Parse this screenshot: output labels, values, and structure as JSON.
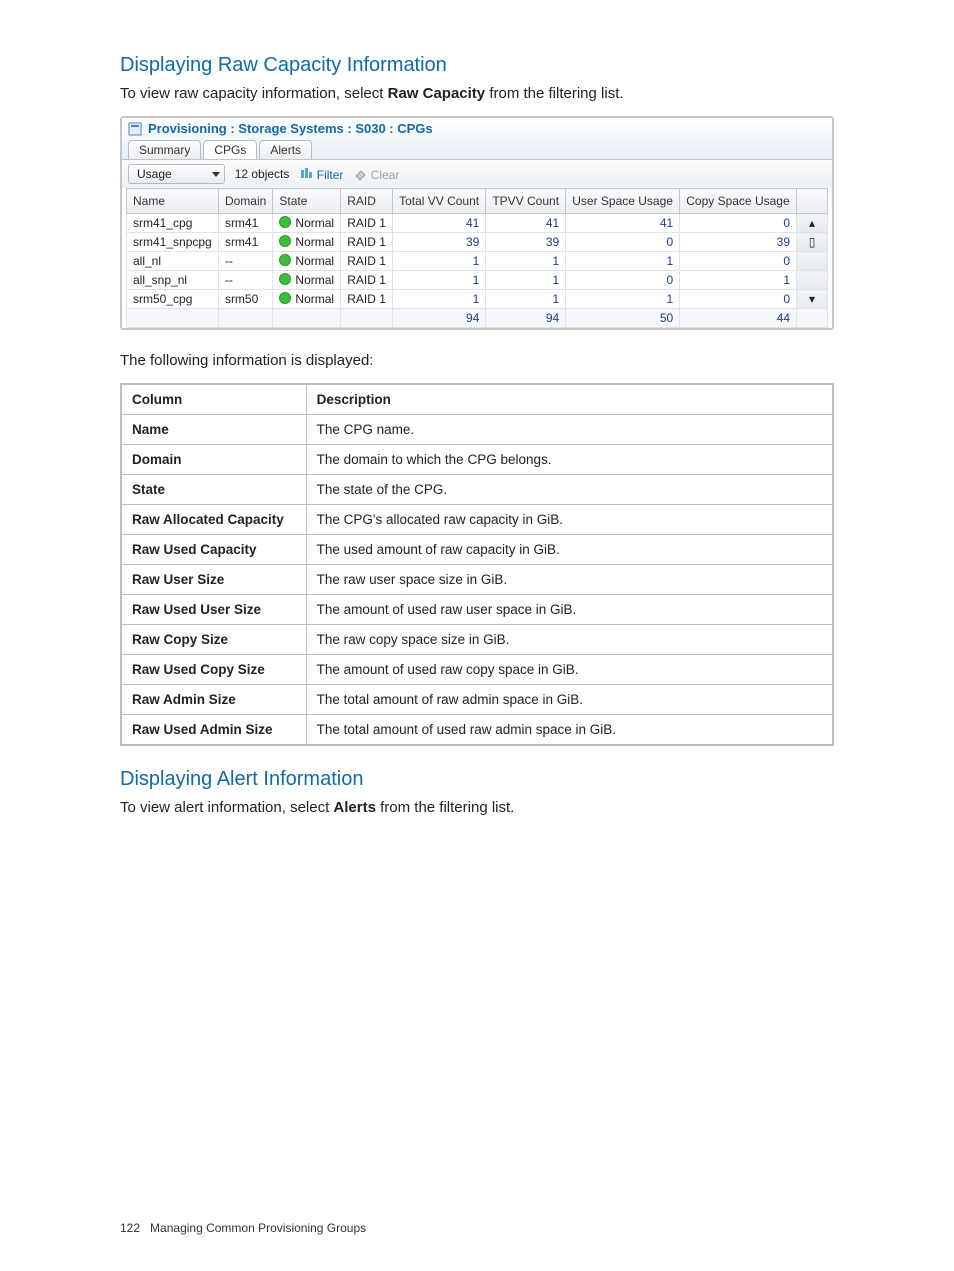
{
  "section1": {
    "heading": "Displaying Raw Capacity Information",
    "intro_pre": "To view raw capacity information, select ",
    "intro_bold": "Raw Capacity",
    "intro_post": " from the filtering list."
  },
  "app": {
    "title": "Provisioning : Storage Systems : S030 : CPGs",
    "tabs": {
      "summary": "Summary",
      "cpgs": "CPGs",
      "alerts": "Alerts"
    },
    "toolbar": {
      "dropdown_value": "Usage",
      "object_count": "12 objects",
      "filter_label": "Filter",
      "clear_label": "Clear"
    },
    "columns": {
      "name": "Name",
      "domain": "Domain",
      "state": "State",
      "raid": "RAID",
      "total_vv": "Total VV Count",
      "tpvv": "TPVV Count",
      "user_space_usage": "User Space Usage",
      "copy_space_usage": "Copy Space Usage"
    },
    "state_label": "Normal",
    "rows": [
      {
        "name": "srm41_cpg",
        "domain": "srm41",
        "raid": "RAID 1",
        "total_vv": "41",
        "tpvv": "41",
        "user": "41",
        "copy": "0"
      },
      {
        "name": "srm41_snpcpg",
        "domain": "srm41",
        "raid": "RAID 1",
        "total_vv": "39",
        "tpvv": "39",
        "user": "0",
        "copy": "39"
      },
      {
        "name": "all_nl",
        "domain": "--",
        "raid": "RAID 1",
        "total_vv": "1",
        "tpvv": "1",
        "user": "1",
        "copy": "0"
      },
      {
        "name": "all_snp_nl",
        "domain": "--",
        "raid": "RAID 1",
        "total_vv": "1",
        "tpvv": "1",
        "user": "0",
        "copy": "1"
      },
      {
        "name": "srm50_cpg",
        "domain": "srm50",
        "raid": "RAID 1",
        "total_vv": "1",
        "tpvv": "1",
        "user": "1",
        "copy": "0"
      }
    ],
    "totals": {
      "total_vv": "94",
      "tpvv": "94",
      "user": "50",
      "copy": "44"
    }
  },
  "between_text": "The following information is displayed:",
  "desc_header": {
    "column": "Column",
    "description": "Description"
  },
  "desc_rows": [
    {
      "col": "Name",
      "desc": "The CPG name."
    },
    {
      "col": "Domain",
      "desc": "The domain to which the CPG belongs."
    },
    {
      "col": "State",
      "desc": "The state of the CPG."
    },
    {
      "col": "Raw Allocated Capacity",
      "desc": "The CPG's allocated raw capacity in GiB."
    },
    {
      "col": "Raw Used Capacity",
      "desc": "The used amount of raw capacity in GiB."
    },
    {
      "col": "Raw User Size",
      "desc": "The raw user space size in GiB."
    },
    {
      "col": "Raw Used User Size",
      "desc": "The amount of used raw user space in GiB."
    },
    {
      "col": "Raw Copy Size",
      "desc": "The raw copy space size in GiB."
    },
    {
      "col": "Raw Used Copy Size",
      "desc": "The amount of used raw copy space in GiB."
    },
    {
      "col": "Raw Admin Size",
      "desc": "The total amount of raw admin space in GiB."
    },
    {
      "col": "Raw Used Admin Size",
      "desc": "The total amount of used raw admin space in GiB."
    }
  ],
  "section2": {
    "heading": "Displaying Alert Information",
    "intro_pre": "To view alert information, select ",
    "intro_bold": "Alerts",
    "intro_post": " from the filtering list."
  },
  "footer": {
    "page_no": "122",
    "title": "Managing Common Provisioning Groups"
  }
}
